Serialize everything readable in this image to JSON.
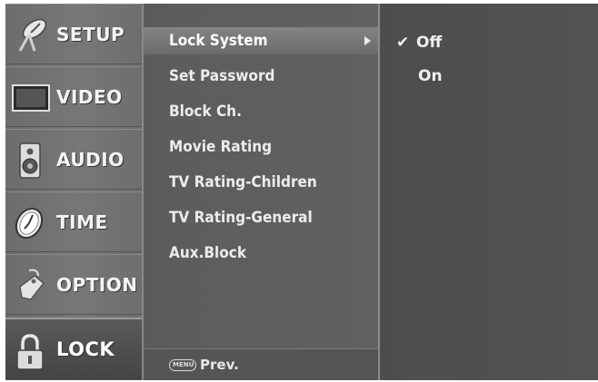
{
  "categories": [
    {
      "label": "SETUP",
      "icon": "satellite-dish-icon",
      "selected": false
    },
    {
      "label": "VIDEO",
      "icon": "tv-screen-icon",
      "selected": false
    },
    {
      "label": "AUDIO",
      "icon": "speaker-icon",
      "selected": false
    },
    {
      "label": "TIME",
      "icon": "clock-icon",
      "selected": false
    },
    {
      "label": "OPTION",
      "icon": "tag-icon",
      "selected": false
    },
    {
      "label": "LOCK",
      "icon": "padlock-icon",
      "selected": true
    }
  ],
  "submenu": {
    "items": [
      {
        "label": "Lock System",
        "selected": true
      },
      {
        "label": "Set Password",
        "selected": false
      },
      {
        "label": "Block Ch.",
        "selected": false
      },
      {
        "label": "Movie Rating",
        "selected": false
      },
      {
        "label": "TV Rating-Children",
        "selected": false
      },
      {
        "label": "TV Rating-General",
        "selected": false
      },
      {
        "label": "Aux.Block",
        "selected": false
      }
    ],
    "prev_button": "MENU",
    "prev_label": "Prev."
  },
  "options": {
    "items": [
      {
        "label": "Off",
        "checked": true
      },
      {
        "label": "On",
        "checked": false
      }
    ],
    "check_glyph": "✔"
  },
  "colors": {
    "background": "#ffffff",
    "category_bg": "#737373",
    "submenu_bg": "#5e5e5e",
    "options_bg": "#4f4f4f",
    "text": "#ececec"
  }
}
